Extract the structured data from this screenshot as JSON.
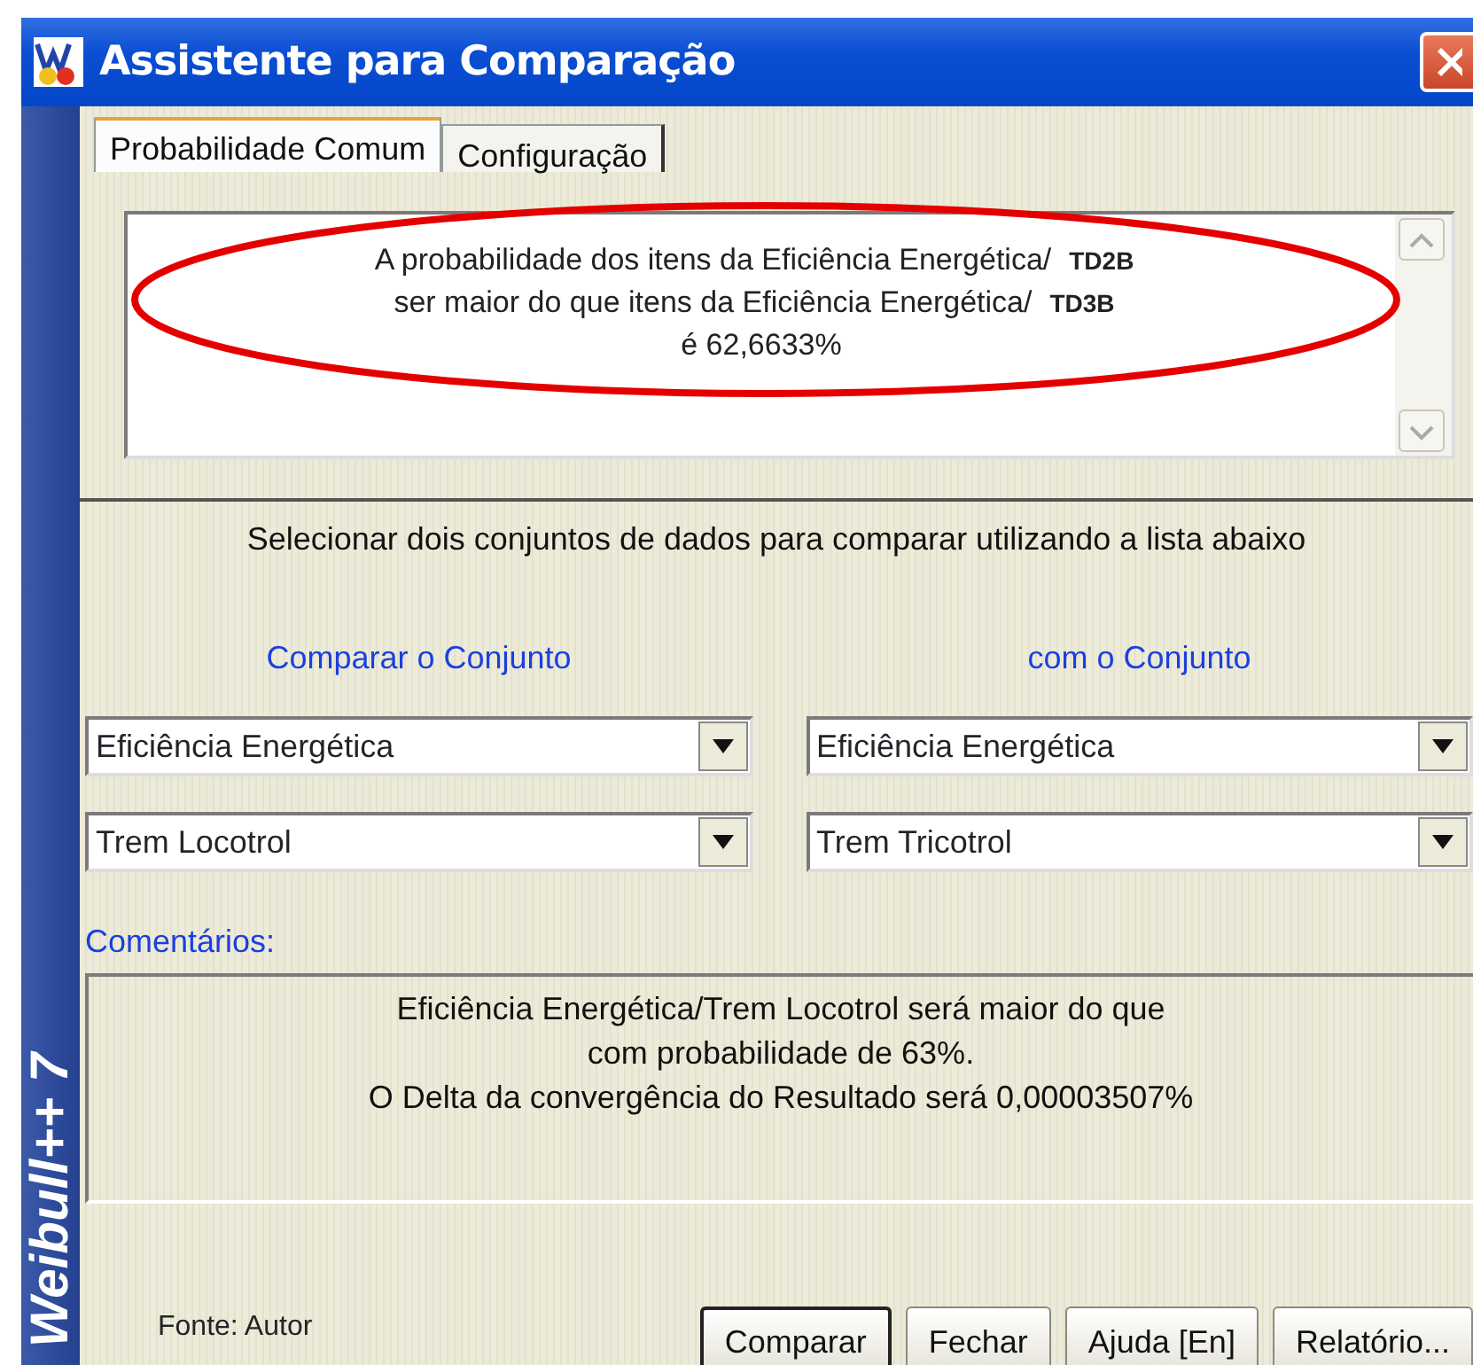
{
  "window": {
    "title": "Assistente para Comparação"
  },
  "sidebar": {
    "brand": "Weibull++ 7"
  },
  "tabs": [
    {
      "label": "Probabilidade Comum",
      "selected": true
    },
    {
      "label": "Configuração",
      "selected": false
    }
  ],
  "result": {
    "lines": [
      "A probabilidade dos itens da Eficiência Energética/",
      "ser maior do que itens da Eficiência Energética/",
      "é 62,6633%"
    ],
    "overlay_labels": [
      "TD2B",
      "TD3B"
    ]
  },
  "instruction": "Selecionar dois conjuntos de dados para comparar utilizando a lista abaixo",
  "compare": [
    {
      "label": "Comparar o Conjunto",
      "dropdowns": [
        "Eficiência Energética",
        "Trem Locotrol"
      ]
    },
    {
      "label": "com o Conjunto",
      "dropdowns": [
        "Eficiência Energética",
        "Trem Tricotrol"
      ]
    }
  ],
  "comments": {
    "label": "Comentários:",
    "lines": [
      "Eficiência Energética/Trem Locotrol será maior do que",
      "com probabilidade de 63%.",
      "O Delta da convergência do Resultado será 0,00003507%"
    ]
  },
  "source_note": "Fonte: Autor",
  "buttons": [
    {
      "label": "Comparar",
      "default": true
    },
    {
      "label": "Fechar",
      "default": false
    },
    {
      "label": "Ajuda [En]",
      "default": false
    },
    {
      "label": "Relatório...",
      "default": false
    }
  ]
}
